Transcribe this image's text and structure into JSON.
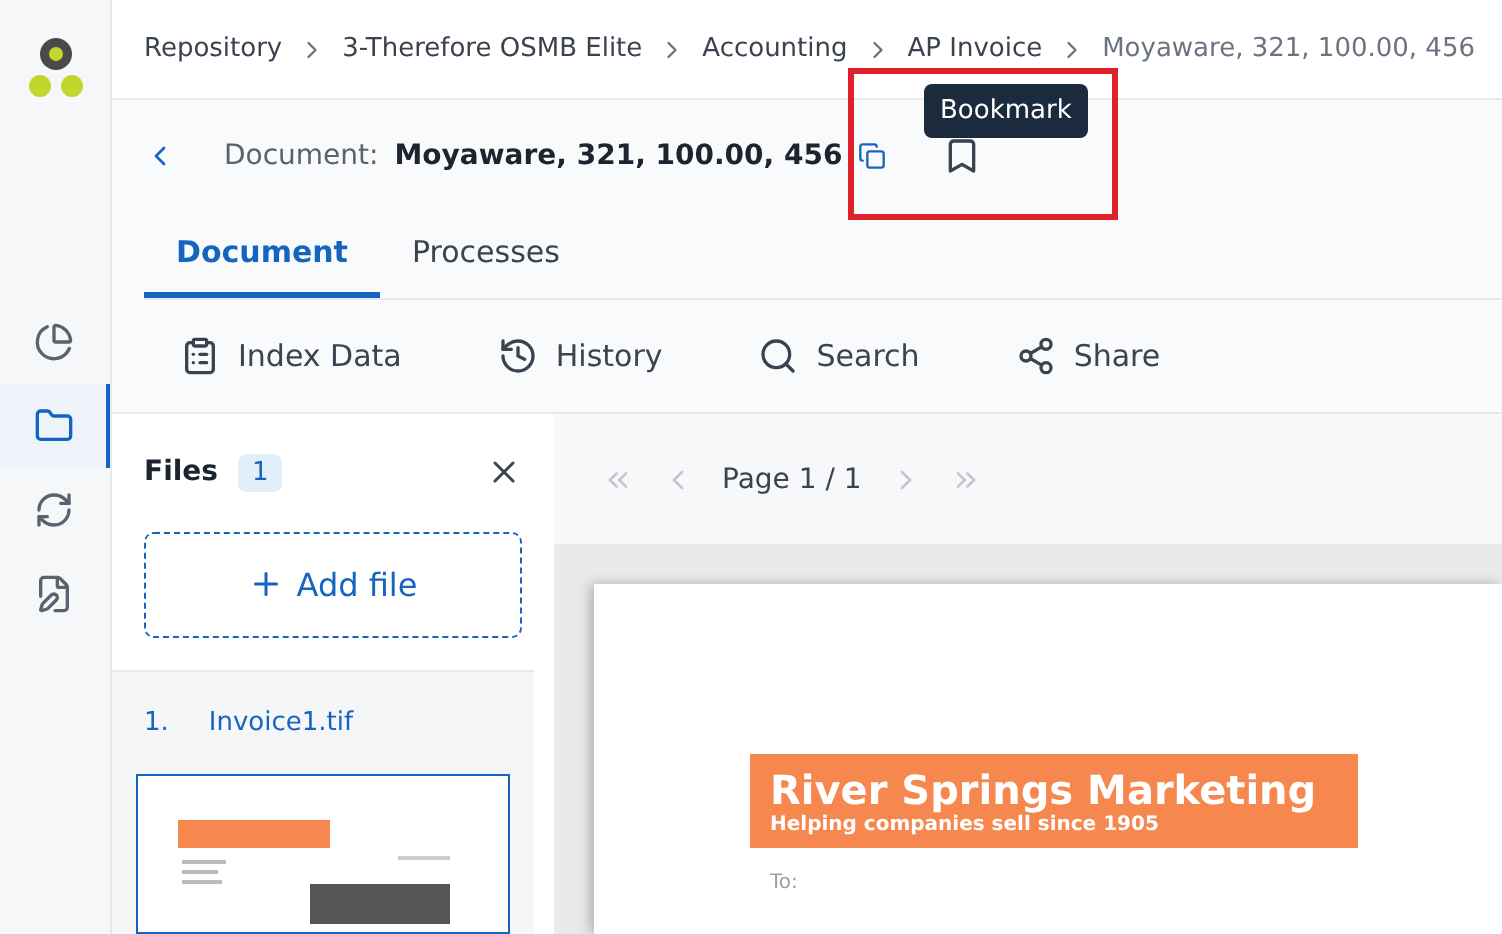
{
  "rail": [
    {
      "kind": "chart",
      "selected": false
    },
    {
      "kind": "folder",
      "selected": true
    },
    {
      "kind": "sync",
      "selected": false
    },
    {
      "kind": "form",
      "selected": false
    }
  ],
  "breadcrumb": [
    "Repository",
    "3-Therefore OSMB Elite",
    "Accounting",
    "AP Invoice",
    "Moyaware, 321, 100.00, 456"
  ],
  "document": {
    "label": "Document:",
    "title": "Moyaware, 321, 100.00, 456"
  },
  "tooltip": "Bookmark",
  "tabs": [
    {
      "label": "Document",
      "selected": true
    },
    {
      "label": "Processes",
      "selected": false
    }
  ],
  "toolbar": [
    {
      "kind": "index",
      "label": "Index Data"
    },
    {
      "kind": "history",
      "label": "History"
    },
    {
      "kind": "search",
      "label": "Search"
    },
    {
      "kind": "share",
      "label": "Share"
    }
  ],
  "files": {
    "title": "Files",
    "count": "1",
    "add": "Add file",
    "items": [
      {
        "number": "1.",
        "name": "Invoice1.tif",
        "selected": true
      }
    ]
  },
  "pager": {
    "label": "Page 1 / 1"
  },
  "page": {
    "company": "River Springs Marketing",
    "tagline": "Helping companies sell since 1905",
    "to": "To:"
  }
}
